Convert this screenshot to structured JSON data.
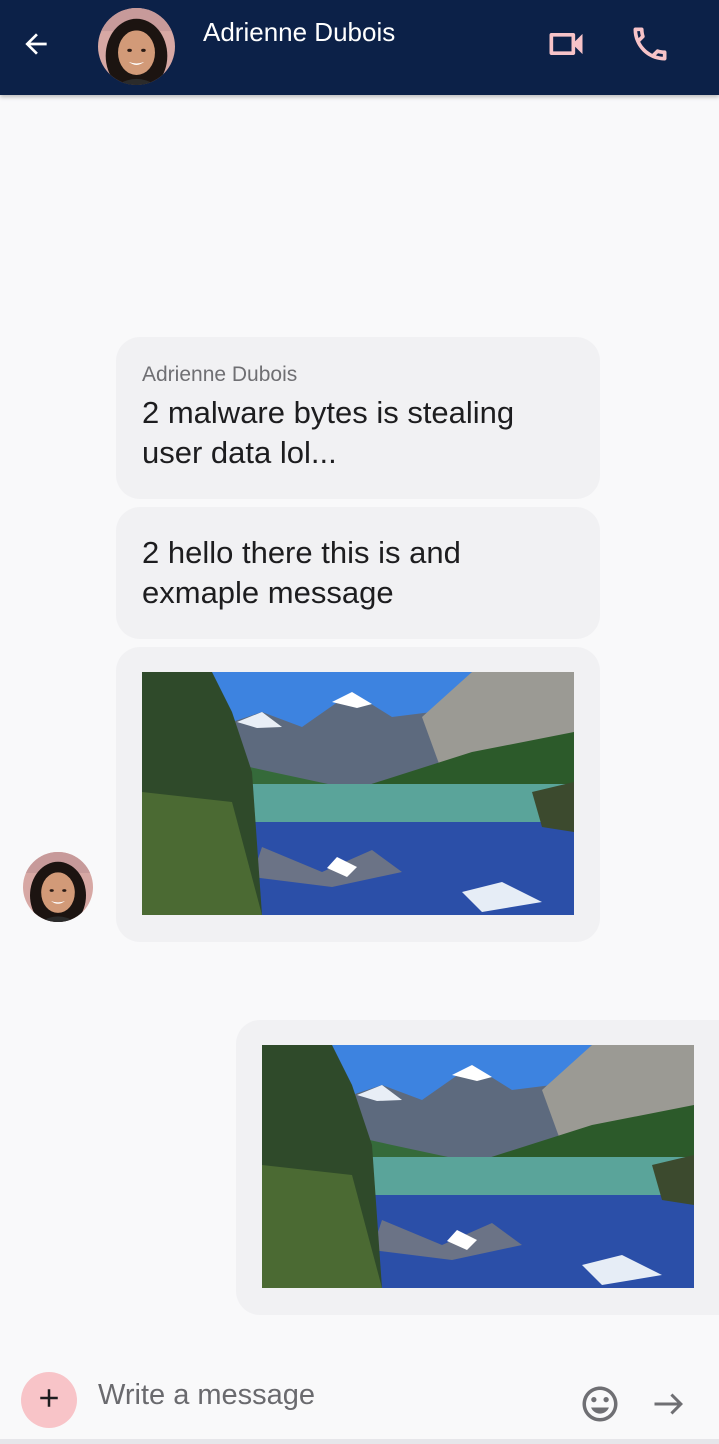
{
  "header": {
    "contact_name": "Adrienne Dubois",
    "bg_color": "#0c2148",
    "icons": {
      "back": "arrow-left-icon",
      "avatar": "avatar",
      "video": "video-camera-icon",
      "call": "phone-icon"
    },
    "icon_color": "#f7c3c8"
  },
  "messages": [
    {
      "direction": "incoming",
      "sender": "Adrienne Dubois",
      "text": "2 malware bytes is stealing user data lol..."
    },
    {
      "direction": "incoming",
      "text": "2 hello there this is and exmaple message"
    },
    {
      "direction": "incoming",
      "type": "image",
      "image": "mountain-lake-photo"
    },
    {
      "direction": "outgoing",
      "type": "image",
      "image": "mountain-lake-photo"
    }
  ],
  "composer": {
    "placeholder": "Write a message",
    "value": "",
    "icons": {
      "add": "plus-icon",
      "emoji": "smiley-icon",
      "send": "arrow-right-icon"
    },
    "add_button_color": "#f8c4c8"
  }
}
